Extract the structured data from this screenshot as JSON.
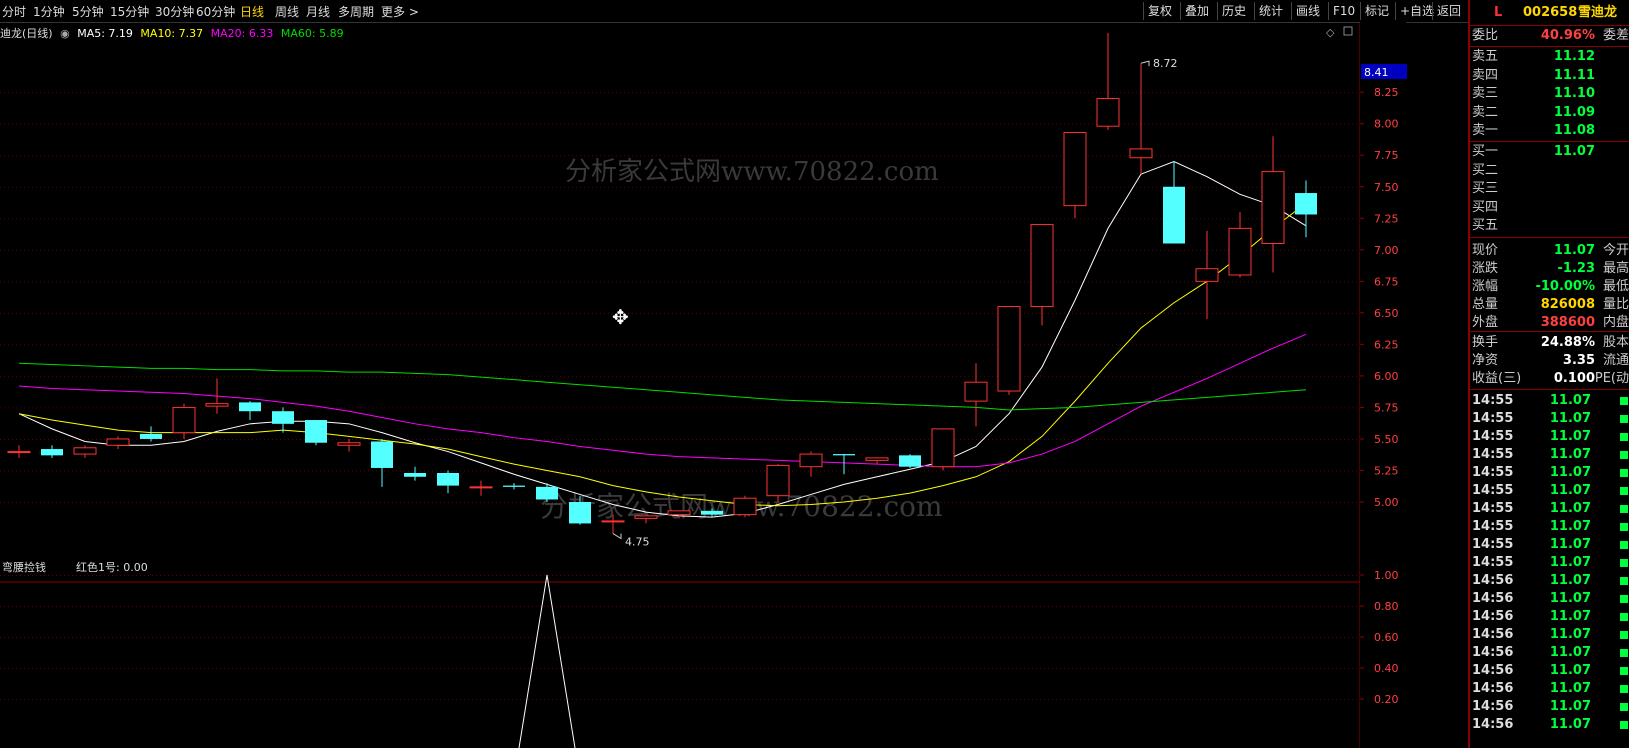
{
  "toolbar": {
    "timeframes": [
      "分时",
      "1分钟",
      "5分钟",
      "15分钟",
      "30分钟",
      "60分钟",
      "日线",
      "周线",
      "月线",
      "多周期",
      "更多 >"
    ],
    "active": "日线",
    "right_buttons": [
      "复权",
      "叠加",
      "历史",
      "统计",
      "画线",
      "F10",
      "标记",
      "+自选",
      "返回"
    ]
  },
  "info_line": {
    "title": "迪龙(日线)",
    "ma5": "MA5: 7.19",
    "ma10": "MA10: 7.37",
    "ma20": "MA20: 6.33",
    "ma60": "MA60: 5.89"
  },
  "indicator_label": {
    "name": "弯腰捡钱",
    "value": "红色1号: 0.00"
  },
  "watermark": "分析家公式网www.70822.com",
  "chart_data": {
    "type": "candlestick",
    "price_axis": [
      "8.41",
      "8.25",
      "8.00",
      "7.75",
      "7.50",
      "7.25",
      "7.00",
      "6.75",
      "6.50",
      "6.25",
      "6.00",
      "5.75",
      "5.50",
      "5.25",
      "5.00"
    ],
    "price_highlight": "8.41",
    "ylim": [
      4.55,
      8.9
    ],
    "annotations": [
      {
        "text": "8.72",
        "index": 34
      },
      {
        "text": "4.75",
        "index": 18
      }
    ],
    "candles": [
      {
        "o": 5.4,
        "h": 5.45,
        "l": 5.35,
        "c": 5.4
      },
      {
        "o": 5.42,
        "h": 5.45,
        "l": 5.35,
        "c": 5.37
      },
      {
        "o": 5.38,
        "h": 5.45,
        "l": 5.35,
        "c": 5.43
      },
      {
        "o": 5.45,
        "h": 5.52,
        "l": 5.42,
        "c": 5.5
      },
      {
        "o": 5.54,
        "h": 5.6,
        "l": 5.48,
        "c": 5.5
      },
      {
        "o": 5.55,
        "h": 5.78,
        "l": 5.5,
        "c": 5.75
      },
      {
        "o": 5.76,
        "h": 5.98,
        "l": 5.7,
        "c": 5.78
      },
      {
        "o": 5.79,
        "h": 5.8,
        "l": 5.65,
        "c": 5.72
      },
      {
        "o": 5.72,
        "h": 5.75,
        "l": 5.55,
        "c": 5.62
      },
      {
        "o": 5.65,
        "h": 5.65,
        "l": 5.45,
        "c": 5.47
      },
      {
        "o": 5.45,
        "h": 5.5,
        "l": 5.4,
        "c": 5.47
      },
      {
        "o": 5.48,
        "h": 5.5,
        "l": 5.12,
        "c": 5.27
      },
      {
        "o": 5.23,
        "h": 5.28,
        "l": 5.17,
        "c": 5.2
      },
      {
        "o": 5.23,
        "h": 5.25,
        "l": 5.07,
        "c": 5.13
      },
      {
        "o": 5.12,
        "h": 5.17,
        "l": 5.05,
        "c": 5.12
      },
      {
        "o": 5.13,
        "h": 5.15,
        "l": 5.1,
        "c": 5.12
      },
      {
        "o": 5.12,
        "h": 5.15,
        "l": 5.0,
        "c": 5.02
      },
      {
        "o": 5.0,
        "h": 5.05,
        "l": 4.82,
        "c": 4.83
      },
      {
        "o": 4.85,
        "h": 4.9,
        "l": 4.75,
        "c": 4.85
      },
      {
        "o": 4.87,
        "h": 4.89,
        "l": 4.83,
        "c": 4.89
      },
      {
        "o": 4.9,
        "h": 4.93,
        "l": 4.87,
        "c": 4.93
      },
      {
        "o": 4.93,
        "h": 4.95,
        "l": 4.88,
        "c": 4.9
      },
      {
        "o": 4.9,
        "h": 5.05,
        "l": 4.88,
        "c": 5.03
      },
      {
        "o": 5.05,
        "h": 5.3,
        "l": 5.0,
        "c": 5.29
      },
      {
        "o": 5.28,
        "h": 5.4,
        "l": 5.2,
        "c": 5.38
      },
      {
        "o": 5.38,
        "h": 5.38,
        "l": 5.22,
        "c": 5.37
      },
      {
        "o": 5.33,
        "h": 5.35,
        "l": 5.3,
        "c": 5.35
      },
      {
        "o": 5.37,
        "h": 5.38,
        "l": 5.27,
        "c": 5.28
      },
      {
        "o": 5.28,
        "h": 5.58,
        "l": 5.25,
        "c": 5.58
      },
      {
        "o": 5.8,
        "h": 6.1,
        "l": 5.6,
        "c": 5.95
      },
      {
        "o": 5.88,
        "h": 6.55,
        "l": 5.85,
        "c": 6.55
      },
      {
        "o": 6.55,
        "h": 7.2,
        "l": 6.4,
        "c": 7.2
      },
      {
        "o": 7.35,
        "h": 7.85,
        "l": 7.25,
        "c": 7.93
      },
      {
        "o": 7.98,
        "h": 8.72,
        "l": 7.95,
        "c": 8.2
      },
      {
        "o": 7.73,
        "h": 8.48,
        "l": 7.6,
        "c": 7.8
      },
      {
        "o": 7.5,
        "h": 7.7,
        "l": 7.05,
        "c": 7.05
      },
      {
        "o": 6.75,
        "h": 7.15,
        "l": 6.45,
        "c": 6.85
      },
      {
        "o": 6.8,
        "h": 7.3,
        "l": 6.78,
        "c": 7.17
      },
      {
        "o": 7.05,
        "h": 7.9,
        "l": 6.82,
        "c": 7.62
      },
      {
        "o": 7.45,
        "h": 7.55,
        "l": 7.1,
        "c": 7.28
      }
    ],
    "ma_lines": {
      "MA5": {
        "color": "#ffffff",
        "values": [
          5.7,
          5.58,
          5.48,
          5.45,
          5.45,
          5.48,
          5.56,
          5.62,
          5.64,
          5.64,
          5.62,
          5.55,
          5.47,
          5.4,
          5.31,
          5.22,
          5.14,
          5.06,
          4.98,
          4.92,
          4.89,
          4.88,
          4.91,
          4.98,
          5.06,
          5.14,
          5.2,
          5.26,
          5.32,
          5.44,
          5.7,
          6.07,
          6.6,
          7.17,
          7.6,
          7.7,
          7.58,
          7.44,
          7.35,
          7.19
        ]
      },
      "MA10": {
        "color": "#ffff00",
        "values": [
          5.7,
          5.65,
          5.61,
          5.57,
          5.55,
          5.55,
          5.55,
          5.55,
          5.57,
          5.55,
          5.52,
          5.49,
          5.46,
          5.42,
          5.36,
          5.3,
          5.25,
          5.2,
          5.13,
          5.08,
          5.04,
          5.01,
          4.98,
          4.97,
          4.98,
          5.0,
          5.03,
          5.07,
          5.13,
          5.2,
          5.32,
          5.52,
          5.8,
          6.1,
          6.38,
          6.58,
          6.75,
          6.95,
          7.17,
          7.37
        ]
      },
      "MA20": {
        "color": "#ff00ff",
        "values": [
          5.92,
          5.9,
          5.89,
          5.88,
          5.87,
          5.86,
          5.84,
          5.82,
          5.79,
          5.76,
          5.72,
          5.67,
          5.62,
          5.58,
          5.55,
          5.51,
          5.48,
          5.44,
          5.41,
          5.38,
          5.36,
          5.35,
          5.34,
          5.33,
          5.32,
          5.31,
          5.3,
          5.29,
          5.28,
          5.28,
          5.31,
          5.38,
          5.48,
          5.62,
          5.76,
          5.87,
          5.98,
          6.1,
          6.22,
          6.33
        ]
      },
      "MA60": {
        "color": "#00dd00",
        "values": [
          6.1,
          6.09,
          6.08,
          6.07,
          6.06,
          6.06,
          6.05,
          6.05,
          6.04,
          6.04,
          6.03,
          6.03,
          6.02,
          6.01,
          5.99,
          5.97,
          5.95,
          5.93,
          5.91,
          5.89,
          5.87,
          5.85,
          5.83,
          5.81,
          5.8,
          5.79,
          5.78,
          5.77,
          5.76,
          5.75,
          5.73,
          5.74,
          5.75,
          5.77,
          5.79,
          5.81,
          5.83,
          5.85,
          5.87,
          5.89
        ]
      }
    },
    "indicator": {
      "axis": [
        "1.00",
        "0.80",
        "0.60",
        "0.40",
        "0.20"
      ],
      "ylim": [
        0,
        1.0
      ],
      "spike_index": 16,
      "spike_value": 1.0
    }
  },
  "right_panel": {
    "header": {
      "flag": "L",
      "code": "002658",
      "name": "雪迪龙"
    },
    "weibi": {
      "label": "委比",
      "value": "40.96%",
      "right": "委差"
    },
    "asks": [
      {
        "label": "卖五",
        "price": "11.12"
      },
      {
        "label": "卖四",
        "price": "11.11"
      },
      {
        "label": "卖三",
        "price": "11.10"
      },
      {
        "label": "卖二",
        "price": "11.09"
      },
      {
        "label": "卖一",
        "price": "11.08"
      }
    ],
    "bids": [
      {
        "label": "买一",
        "price": "11.07"
      },
      {
        "label": "买二",
        "price": ""
      },
      {
        "label": "买三",
        "price": ""
      },
      {
        "label": "买四",
        "price": ""
      },
      {
        "label": "买五",
        "price": ""
      }
    ],
    "stats": [
      {
        "label": "现价",
        "value": "11.07",
        "right": "今开",
        "color": "#00ff3c"
      },
      {
        "label": "涨跌",
        "value": "-1.23",
        "right": "最高",
        "color": "#00ff3c"
      },
      {
        "label": "涨幅",
        "value": "-10.00%",
        "right": "最低",
        "color": "#00ff3c"
      },
      {
        "label": "总量",
        "value": "826008",
        "right": "量比",
        "color": "#ffd700"
      },
      {
        "label": "外盘",
        "value": "388600",
        "right": "内盘",
        "color": "#ff4040"
      }
    ],
    "stats2": [
      {
        "label": "换手",
        "value": "24.88%",
        "right": "股本",
        "color": "#ffffff"
      },
      {
        "label": "净资",
        "value": "3.35",
        "right": "流通",
        "color": "#ffffff"
      },
      {
        "label": "收益(三)",
        "value": "0.100",
        "right": "PE(动",
        "color": "#ffffff"
      }
    ],
    "ticks": [
      {
        "time": "14:55",
        "price": "11.07"
      },
      {
        "time": "14:55",
        "price": "11.07"
      },
      {
        "time": "14:55",
        "price": "11.07"
      },
      {
        "time": "14:55",
        "price": "11.07"
      },
      {
        "time": "14:55",
        "price": "11.07"
      },
      {
        "time": "14:55",
        "price": "11.07"
      },
      {
        "time": "14:55",
        "price": "11.07"
      },
      {
        "time": "14:55",
        "price": "11.07"
      },
      {
        "time": "14:55",
        "price": "11.07"
      },
      {
        "time": "14:55",
        "price": "11.07"
      },
      {
        "time": "14:56",
        "price": "11.07"
      },
      {
        "time": "14:56",
        "price": "11.07"
      },
      {
        "time": "14:56",
        "price": "11.07"
      },
      {
        "time": "14:56",
        "price": "11.07"
      },
      {
        "time": "14:56",
        "price": "11.07"
      },
      {
        "time": "14:56",
        "price": "11.07"
      },
      {
        "time": "14:56",
        "price": "11.07"
      },
      {
        "time": "14:56",
        "price": "11.07"
      },
      {
        "time": "14:56",
        "price": "11.07"
      }
    ]
  }
}
